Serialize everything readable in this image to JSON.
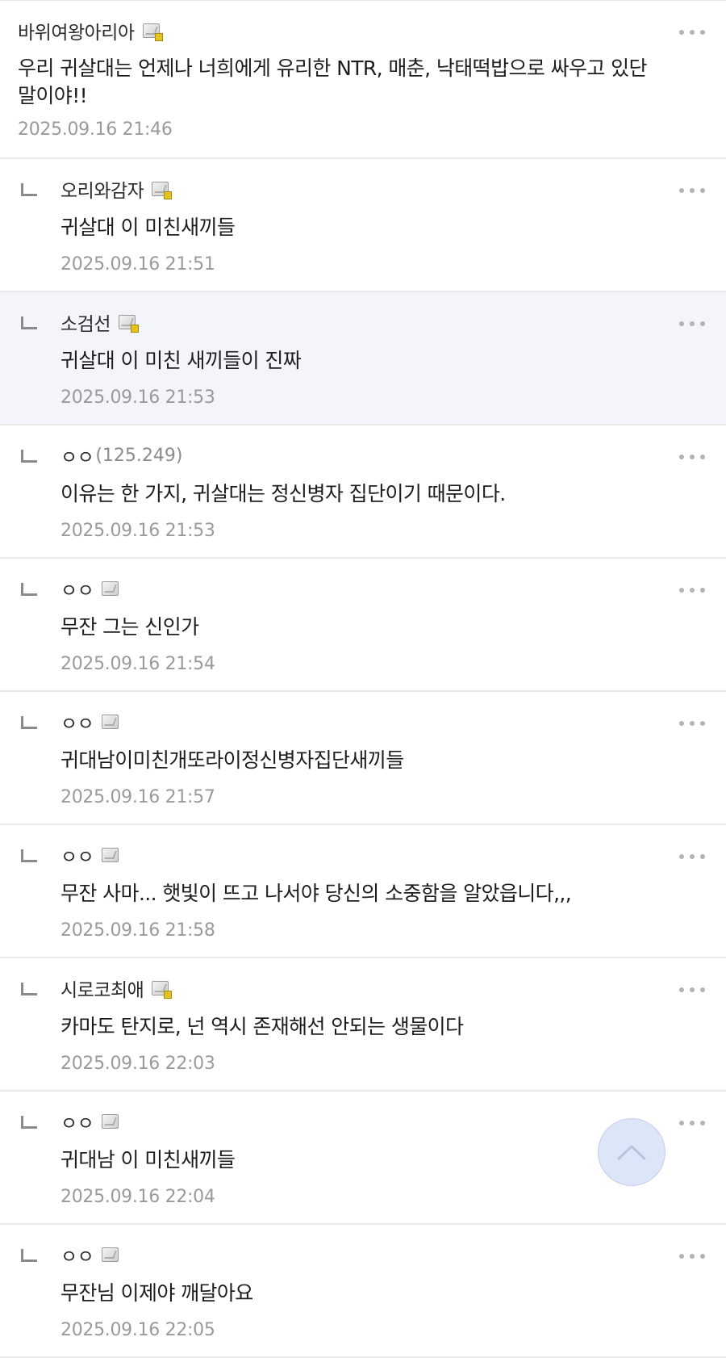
{
  "comments": [
    {
      "type": "root",
      "nick": "바위여왕아리아",
      "ip": "",
      "badge": "gold",
      "text": "우리 귀살대는 언제나 너희에게 유리한 NTR, 매춘, 낙태떡밥으로 싸우고 있단 말이야!!",
      "time": "2025.09.16 21:46"
    },
    {
      "type": "reply",
      "nick": "오리와감자",
      "ip": "",
      "badge": "gold",
      "text": "귀살대 이 미친새끼들",
      "time": "2025.09.16 21:51"
    },
    {
      "type": "reply",
      "nick": "소검선",
      "ip": "",
      "badge": "gold",
      "text": "귀살대 이 미친 새끼들이 진짜",
      "time": "2025.09.16 21:53",
      "highlight": true
    },
    {
      "type": "reply",
      "nick": "ㅇㅇ",
      "ip": "(125.249)",
      "badge": "none",
      "text": "이유는 한 가지, 귀살대는 정신병자 집단이기 때문이다.",
      "time": "2025.09.16 21:53"
    },
    {
      "type": "reply",
      "nick": "ㅇㅇ",
      "ip": "",
      "badge": "gray",
      "text": "무잔 그는 신인가",
      "time": "2025.09.16 21:54"
    },
    {
      "type": "reply",
      "nick": "ㅇㅇ",
      "ip": "",
      "badge": "gray",
      "text": "귀대남이미친개또라이정신병자집단새끼들",
      "time": "2025.09.16 21:57"
    },
    {
      "type": "reply",
      "nick": "ㅇㅇ",
      "ip": "",
      "badge": "gray",
      "text": "무잔 사마... 햇빛이 뜨고 나서야 당신의 소중함을 알았읍니다,,,",
      "time": "2025.09.16 21:58"
    },
    {
      "type": "reply",
      "nick": "시로코최애",
      "ip": "",
      "badge": "gold",
      "text": "카마도 탄지로, 넌 역시 존재해선 안되는 생물이다",
      "time": "2025.09.16 22:03"
    },
    {
      "type": "reply",
      "nick": "ㅇㅇ",
      "ip": "",
      "badge": "gray",
      "text": "귀대남 이 미친새끼들",
      "time": "2025.09.16 22:04"
    },
    {
      "type": "reply",
      "nick": "ㅇㅇ",
      "ip": "",
      "badge": "gray",
      "text": "무잔님 이제야 깨달아요",
      "time": "2025.09.16 22:05"
    }
  ],
  "icons": {
    "more": "more-dots-icon",
    "reply": "reply-arrow-icon",
    "badge": "user-badge-icon",
    "scroll_top": "chevron-up-icon"
  }
}
